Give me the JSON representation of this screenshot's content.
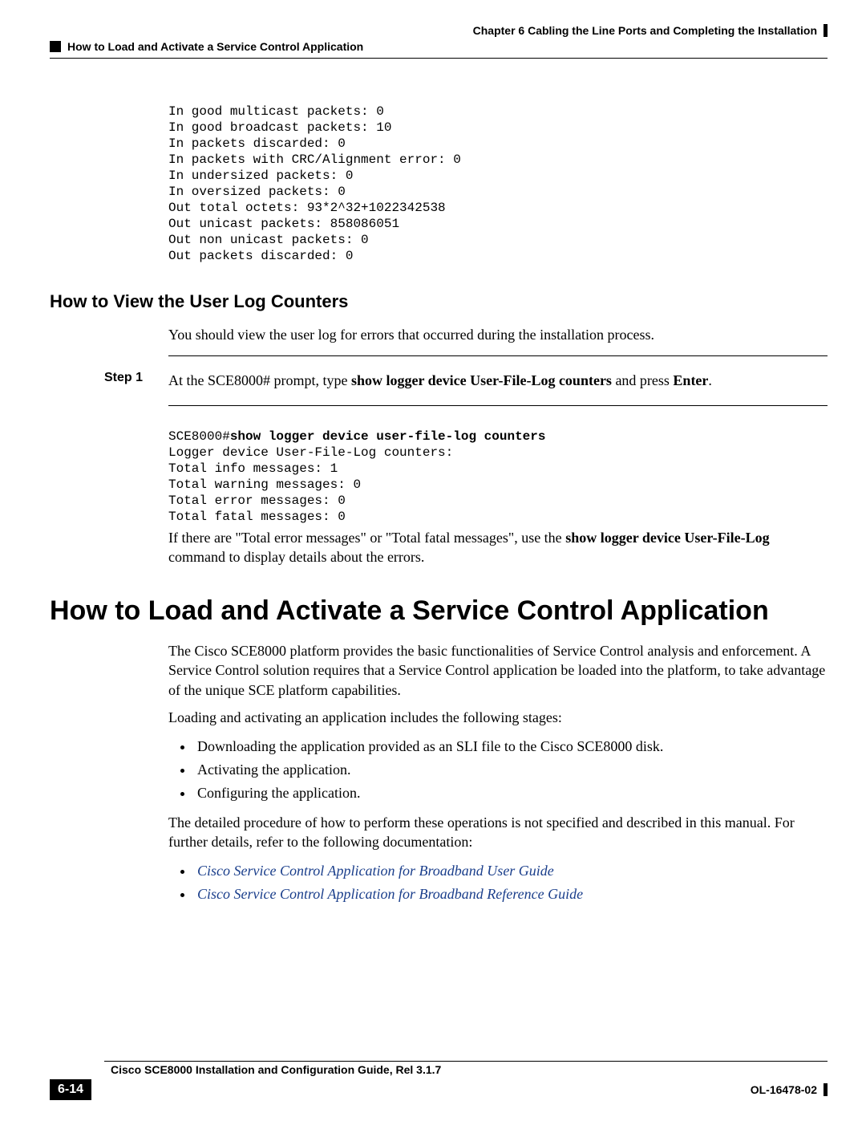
{
  "header": {
    "chapter": "Chapter 6    Cabling the Line Ports and Completing the Installation",
    "section": "How to Load and Activate a Service Control Application"
  },
  "counters_block": "In good multicast packets: 0\nIn good broadcast packets: 10\nIn packets discarded: 0\nIn packets with CRC/Alignment error: 0\nIn undersized packets: 0\nIn oversized packets: 0\nOut total octets: 93*2^32+1022342538\nOut unicast packets: 858086051\nOut non unicast packets: 0\nOut packets discarded: 0",
  "h2_userlog": "How to View the User Log Counters",
  "userlog_intro": "You should view the user log for errors that occurred during the installation process.",
  "step1": {
    "label": "Step 1",
    "pre": "At the SCE8000# prompt, type ",
    "cmd": "show logger device User-File-Log counters",
    "mid": "  and press ",
    "enter": "Enter",
    "post": "."
  },
  "logger_prompt": "SCE8000#",
  "logger_cmd": "show logger device user-file-log counters",
  "logger_output": "Logger device User-File-Log counters:\nTotal info messages: 1\nTotal warning messages: 0\nTotal error messages: 0\nTotal fatal messages: 0",
  "logger_note_pre": "If there are \"Total error messages\" or \"Total fatal messages\", use the ",
  "logger_note_bold": "show logger device User-File-Log",
  "logger_note_post": " command to display details about the errors.",
  "h1_load": "How to Load and Activate a Service Control Application",
  "load_p1": "The Cisco SCE8000 platform provides the basic functionalities of Service Control analysis and enforcement. A Service Control solution requires that a Service Control application be loaded into the platform, to take advantage of the unique SCE platform capabilities.",
  "load_p2": "Loading and activating an application includes the following stages:",
  "stages": [
    "Downloading the application provided as an SLI file to the Cisco SCE8000 disk.",
    "Activating the application.",
    "Configuring the application."
  ],
  "load_p3": "The detailed procedure of how to perform these operations is not specified and described in this manual. For further details, refer to the following documentation:",
  "links": [
    "Cisco Service Control Application for Broadband User Guide",
    "Cisco Service Control Application for Broadband Reference Guide"
  ],
  "footer": {
    "title": "Cisco SCE8000 Installation and Configuration Guide, Rel 3.1.7",
    "page": "6-14",
    "doc": "OL-16478-02"
  }
}
